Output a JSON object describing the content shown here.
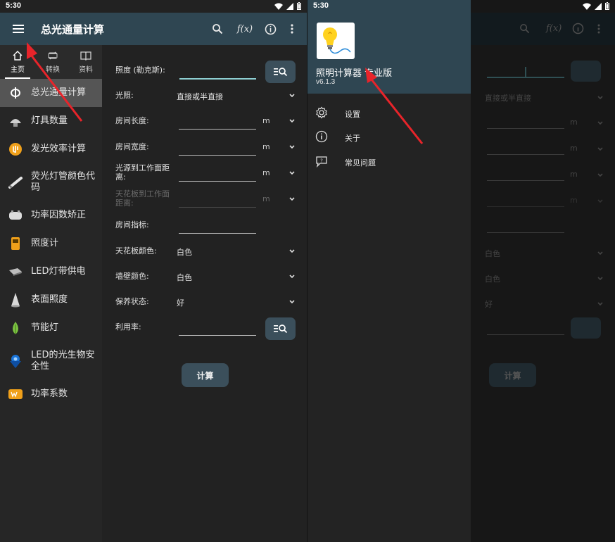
{
  "status": {
    "time": "5:30"
  },
  "left": {
    "appbar": {
      "title": "总光通量计算",
      "func_label": "f(x)"
    },
    "tabs": [
      {
        "label": "主页",
        "icon": "home-icon"
      },
      {
        "label": "转换",
        "icon": "convert-icon"
      },
      {
        "label": "资料",
        "icon": "book-icon"
      }
    ],
    "nav": [
      {
        "label": "总光通量计算",
        "icon": "phi-icon"
      },
      {
        "label": "灯具数量",
        "icon": "lamp-icon"
      },
      {
        "label": "发光效率计算",
        "icon": "efficiency-icon"
      },
      {
        "label": "荧光灯管颜色代码",
        "icon": "tube-icon"
      },
      {
        "label": "功率因数矫正",
        "icon": "capacitor-icon"
      },
      {
        "label": "照度计",
        "icon": "lux-meter-icon"
      },
      {
        "label": "LED灯带供电",
        "icon": "led-strip-icon"
      },
      {
        "label": "表面照度",
        "icon": "spotlight-icon"
      },
      {
        "label": "节能灯",
        "icon": "leaf-icon"
      },
      {
        "label": "LED的光生物安全性",
        "icon": "led-icon"
      },
      {
        "label": "功率系数",
        "icon": "watt-icon"
      }
    ],
    "form": {
      "illuminance_label": "照度 (勒克斯):",
      "lighting_label": "光照:",
      "lighting_value": "直接或半直接",
      "room_length_label": "房间长度:",
      "room_width_label": "房间宽度:",
      "source_height_label": "光源到工作面距离:",
      "ceiling_height_label": "天花板到工作面距离:",
      "room_index_label": "房间指标:",
      "ceiling_color_label": "天花板颜色:",
      "ceiling_color_value": "白色",
      "wall_color_label": "墙壁颜色:",
      "wall_color_value": "白色",
      "maintenance_label": "保养状态:",
      "maintenance_value": "好",
      "utilization_label": "利用率:",
      "unit_m": "m",
      "calc_label": "计算"
    }
  },
  "right": {
    "drawer": {
      "app_name": "照明计算器 专业版",
      "version": "v6.1.3",
      "items": [
        {
          "label": "设置",
          "icon": "gear-icon"
        },
        {
          "label": "关于",
          "icon": "info-icon"
        },
        {
          "label": "常见问题",
          "icon": "faq-icon"
        }
      ]
    },
    "dim_form": {
      "lighting_value": "直接或半直接",
      "ceiling_color_value": "白色",
      "wall_color_value": "白色",
      "maintenance_value": "好",
      "calc_label": "计算",
      "unit_m": "m",
      "func_label": "f(x)"
    }
  },
  "colors": {
    "appbar": "#2f4652",
    "button": "#3b4f5b",
    "accent": "#8ecfd2",
    "arrow": "#e8242a"
  }
}
